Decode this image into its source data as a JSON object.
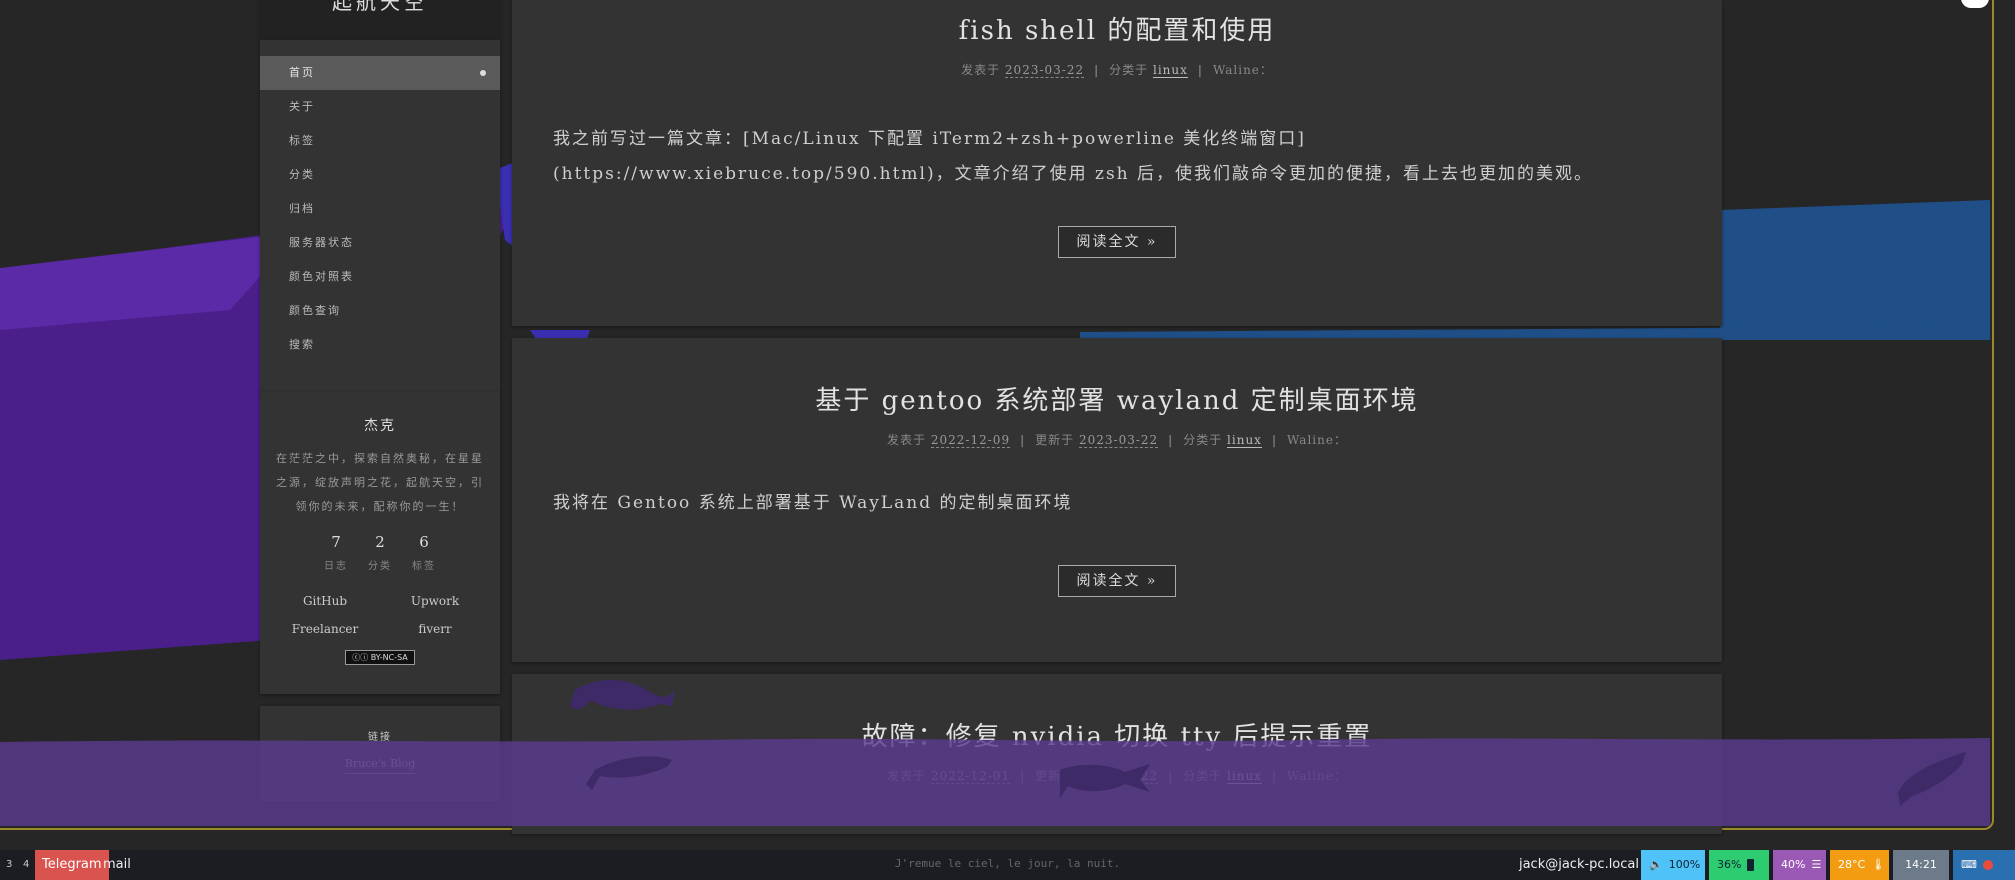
{
  "sidebar": {
    "site_title": "起航天空",
    "menu": [
      {
        "label": "首页",
        "active": true
      },
      {
        "label": "关于"
      },
      {
        "label": "标签"
      },
      {
        "label": "分类"
      },
      {
        "label": "归档"
      },
      {
        "label": "服务器状态"
      },
      {
        "label": "颜色对照表"
      },
      {
        "label": "颜色查询"
      },
      {
        "label": "搜索"
      }
    ],
    "author": {
      "name": "杰克",
      "description": "在茫茫之中，探索自然奥秘，在星星之源，绽放声明之花，起航天空，引领你的未来，配称你的一生！",
      "stats": [
        {
          "count": "7",
          "label": "日志"
        },
        {
          "count": "2",
          "label": "分类"
        },
        {
          "count": "6",
          "label": "标签"
        }
      ],
      "links": [
        "GitHub",
        "Upwork",
        "Freelancer",
        "fiverr"
      ],
      "license": "BY-NC-SA"
    },
    "blogroll": {
      "title": "链接",
      "link": "Bruce's Blog"
    }
  },
  "posts": [
    {
      "title": "fish shell 的配置和使用",
      "posted_label": "发表于",
      "posted": "2023-03-22",
      "category_label": "分类于",
      "category": "linux",
      "waline": "Waline：",
      "excerpt": "我之前写过一篇文章：[Mac/Linux 下配置 iTerm2+zsh+powerline 美化终端窗口](https://www.xiebruce.top/590.html)，文章介绍了使用 zsh 后，使我们敲命令更加的便捷，看上去也更加的美观。",
      "read_more": "阅读全文 »"
    },
    {
      "title": "基于 gentoo 系统部署 wayland 定制桌面环境",
      "posted_label": "发表于",
      "posted": "2022-12-09",
      "updated_label": "更新于",
      "updated": "2023-03-22",
      "category_label": "分类于",
      "category": "linux",
      "waline": "Waline：",
      "excerpt": "我将在 Gentoo 系统上部署基于 WayLand 的定制桌面环境",
      "read_more": "阅读全文 »"
    },
    {
      "title": "故障：修复 nvidia 切换 tty 后提示重置",
      "posted_label": "发表于",
      "posted": "2022-12-01",
      "updated_label": "更新于",
      "updated": "2023-03-22",
      "category_label": "分类于",
      "category": "linux",
      "waline": "Waline："
    }
  ],
  "taskbar": {
    "workspaces": [
      "3",
      "4"
    ],
    "telegram": "Telegram",
    "mail": "mail",
    "quote": "J'remue le ciel, le jour, la nuit.",
    "host": "jack@jack-pc.local",
    "volume": "100%",
    "battery": "36%",
    "cpu": "40%",
    "temp": "28°C",
    "clock": "14:21",
    "colors": {
      "telegram": "#d9534f",
      "volume": "#4fc3f7",
      "battery": "#2ecc71",
      "cpu": "#9b59b6",
      "temp": "#f39c12",
      "clock": "#6c7a89",
      "tray": "#2a6fb0"
    }
  }
}
